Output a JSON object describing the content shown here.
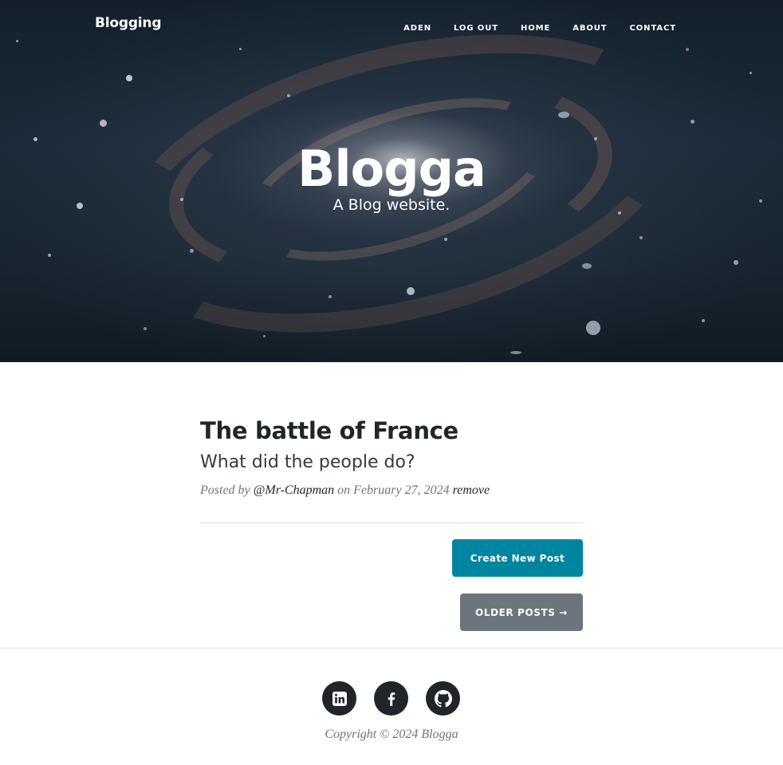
{
  "nav": {
    "brand": "Blogging",
    "links": [
      "ADEN",
      "LOG OUT",
      "HOME",
      "ABOUT",
      "CONTACT"
    ]
  },
  "hero": {
    "title": "Blogga",
    "subtitle": "A Blog website."
  },
  "post": {
    "title": "The battle of France",
    "subtitle": "What did the people do?",
    "meta_prefix": "Posted by",
    "author": "@Mr-Chapman",
    "meta_on": "on",
    "date": "February 27, 2024",
    "remove_label": "remove"
  },
  "buttons": {
    "create": "Create New Post",
    "older": "OLDER POSTS →"
  },
  "footer": {
    "social_icons": [
      "linkedin-icon",
      "facebook-icon",
      "github-icon"
    ],
    "copyright": "Copyright © 2024 Blogga"
  },
  "colors": {
    "primary": "#0085a1",
    "secondary": "#6c757d",
    "dark": "#212529"
  }
}
